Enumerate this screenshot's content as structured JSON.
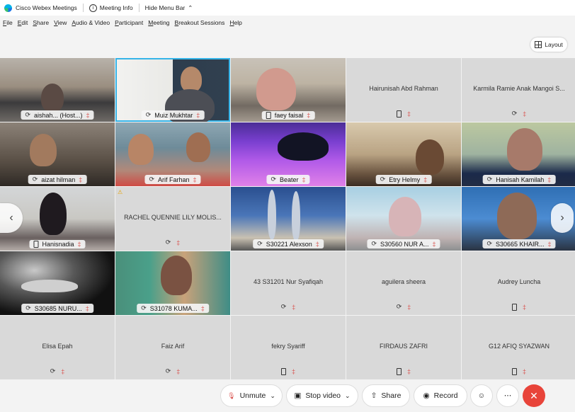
{
  "titlebar": {
    "app_name": "Cisco Webex Meetings",
    "meeting_info": "Meeting Info",
    "hide_menu": "Hide Menu Bar"
  },
  "menu": [
    "File",
    "Edit",
    "Share",
    "View",
    "Audio & Video",
    "Participant",
    "Meeting",
    "Breakout Sessions",
    "Help"
  ],
  "layout_button": "Layout",
  "tiles": [
    {
      "name": "aishah... (Host...)",
      "device": "signal",
      "video": true
    },
    {
      "name": "Muiz Mukhtar",
      "device": "signal",
      "video": true,
      "active": true
    },
    {
      "name": "faey faisal",
      "device": "phone",
      "video": true
    },
    {
      "name": "Hairunisah Abd Rahman",
      "device": "phone",
      "video": false
    },
    {
      "name": "Karmila Ramie Anak Mangoi S...",
      "device": "signal",
      "video": false
    },
    {
      "name": "aizat hilman",
      "device": "signal",
      "video": true
    },
    {
      "name": "Arif Farhan",
      "device": "signal",
      "video": true
    },
    {
      "name": "Beater",
      "device": "signal",
      "video": true
    },
    {
      "name": "Etry Helmy",
      "device": "signal",
      "video": true
    },
    {
      "name": "Hanisah Kamilah",
      "device": "signal",
      "video": true
    },
    {
      "name": "Hanisnadia",
      "device": "phone",
      "video": true
    },
    {
      "name": "RACHEL QUENNIE LILY MOLIS...",
      "device": "signal",
      "video": false,
      "warning": true
    },
    {
      "name": "S30221 Alexson",
      "device": "signal",
      "video": true
    },
    {
      "name": "S30560 NUR A...",
      "device": "signal",
      "video": true
    },
    {
      "name": "S30665 KHAIR...",
      "device": "signal",
      "video": true
    },
    {
      "name": "S30685 NURU...",
      "device": "signal",
      "video": true
    },
    {
      "name": "S31078 KUMA...",
      "device": "signal",
      "video": true
    },
    {
      "name": "43 S31201 Nur Syafiqah",
      "device": "signal",
      "video": false
    },
    {
      "name": "aguilera sheera",
      "device": "signal",
      "video": false
    },
    {
      "name": "Audrey Luncha",
      "device": "phone",
      "video": false
    },
    {
      "name": "Elisa Epah",
      "device": "signal",
      "video": false
    },
    {
      "name": "Faiz Arif",
      "device": "signal",
      "video": false
    },
    {
      "name": "fekry Syariff",
      "device": "phone",
      "video": false
    },
    {
      "name": "FIRDAUS ZAFRI",
      "device": "phone",
      "video": false
    },
    {
      "name": "G12 AFIQ SYAZWAN",
      "device": "phone",
      "video": false
    }
  ],
  "controls": {
    "unmute": "Unmute",
    "stop_video": "Stop video",
    "share": "Share",
    "record": "Record"
  }
}
